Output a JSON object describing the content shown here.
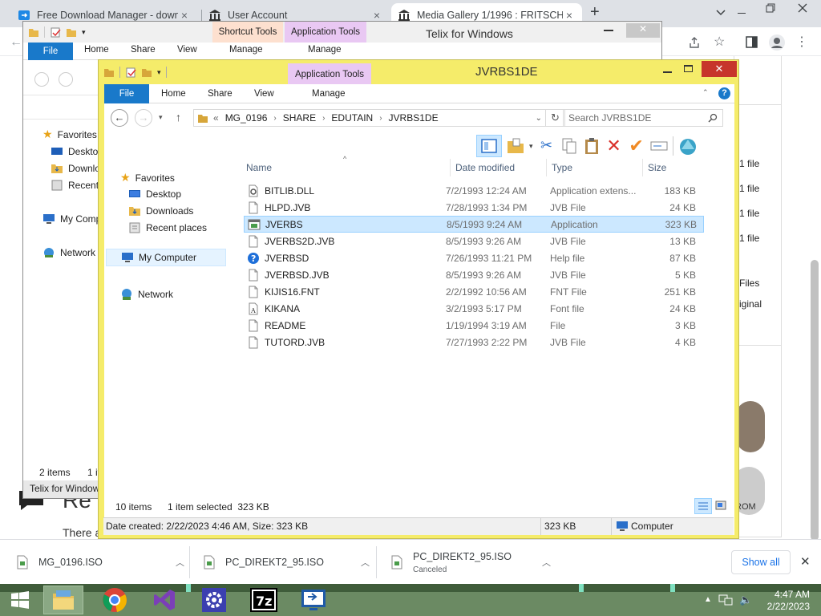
{
  "browser": {
    "tabs": [
      {
        "title": "Free Download Manager - downl",
        "close": "×"
      },
      {
        "title": "User Account",
        "close": "×"
      },
      {
        "title": "Media Gallery 1/1996 : FRITSCH",
        "close": "×"
      }
    ],
    "new_tab": "+",
    "background": {
      "file_labels": [
        "1 file",
        "1 file",
        "1 file",
        "1 file"
      ],
      "files_label": "Files",
      "original_label": "iginal",
      "page_heading": "Re",
      "page_text": "There a",
      "rom_label": "ROM"
    }
  },
  "telix_window": {
    "title": "Telix for Windows",
    "ribbon_tabs": [
      "File",
      "Home",
      "Share",
      "View"
    ],
    "context_tabs": [
      "Shortcut Tools",
      "Application Tools"
    ],
    "manage_labels": [
      "Manage",
      "Manage"
    ],
    "nav": {
      "favorites": "Favorites",
      "items": [
        "Desktop",
        "Downloads",
        "Recent places"
      ],
      "computer": "My Computer",
      "network": "Network"
    },
    "status_left": "2 items",
    "status_right": "1 it",
    "taskbar_label": "Telix for Windows"
  },
  "main_window": {
    "title": "JVRBS1DE",
    "context_tab": "Application Tools",
    "manage_label": "Manage",
    "ribbon_tabs": [
      "File",
      "Home",
      "Share",
      "View"
    ],
    "breadcrumb": {
      "prefix": "«",
      "parts": [
        "MG_0196",
        "SHARE",
        "EDUTAIN",
        "JVRBS1DE"
      ]
    },
    "search_placeholder": "Search JVRBS1DE",
    "nav": {
      "favorites": "Favorites",
      "items": [
        "Desktop",
        "Downloads",
        "Recent places"
      ],
      "computer": "My Computer",
      "network": "Network"
    },
    "columns": [
      "Name",
      "Date modified",
      "Type",
      "Size"
    ],
    "files": [
      {
        "name": "BITLIB.DLL",
        "date": "7/2/1993 12:24 AM",
        "type": "Application extens...",
        "size": "183 KB",
        "icon": "dll-icon"
      },
      {
        "name": "HLPD.JVB",
        "date": "7/28/1993 1:34 PM",
        "type": "JVB File",
        "size": "24 KB",
        "icon": "file-icon"
      },
      {
        "name": "JVERBS",
        "date": "8/5/1993 9:24 AM",
        "type": "Application",
        "size": "323 KB",
        "icon": "app-icon"
      },
      {
        "name": "JVERBS2D.JVB",
        "date": "8/5/1993 9:26 AM",
        "type": "JVB File",
        "size": "13 KB",
        "icon": "file-icon"
      },
      {
        "name": "JVERBSD",
        "date": "7/26/1993 11:21 PM",
        "type": "Help file",
        "size": "87 KB",
        "icon": "help-icon"
      },
      {
        "name": "JVERBSD.JVB",
        "date": "8/5/1993 9:26 AM",
        "type": "JVB File",
        "size": "5 KB",
        "icon": "file-icon"
      },
      {
        "name": "KIJIS16.FNT",
        "date": "2/2/1992 10:56 AM",
        "type": "FNT File",
        "size": "251 KB",
        "icon": "file-icon"
      },
      {
        "name": "KIKANA",
        "date": "3/2/1993 5:17 PM",
        "type": "Font file",
        "size": "24 KB",
        "icon": "font-icon"
      },
      {
        "name": "README",
        "date": "1/19/1994 3:19 AM",
        "type": "File",
        "size": "3 KB",
        "icon": "file-icon"
      },
      {
        "name": "TUTORD.JVB",
        "date": "7/27/1993 2:22 PM",
        "type": "JVB File",
        "size": "4 KB",
        "icon": "file-icon"
      }
    ],
    "status": {
      "items": "10 items",
      "selected": "1 item selected  323 KB"
    },
    "details": {
      "left": "Date created: 2/22/2023 4:46 AM, Size: 323 KB",
      "size": "323 KB",
      "computer": "Computer"
    }
  },
  "downloads": {
    "items": [
      {
        "name": "MG_0196.ISO",
        "status": ""
      },
      {
        "name": "PC_DIREKT2_95.ISO",
        "status": ""
      },
      {
        "name": "PC_DIREKT2_95.ISO",
        "status": "Canceled"
      }
    ],
    "show_all": "Show all",
    "close": "✕"
  },
  "taskbar": {
    "time": "4:47 AM",
    "date": "2/22/2023",
    "apps": [
      "file-explorer",
      "chrome",
      "visual-studio",
      "settings",
      "7zip",
      "remote-desktop"
    ]
  },
  "colors": {
    "window_frame": "#f5ec6a",
    "accent_blue": "#1979ca",
    "context_purple": "#e9c8f3",
    "context_orange": "#fde0cf",
    "selection": "#cce8ff",
    "taskbar": "#6b8a63"
  }
}
